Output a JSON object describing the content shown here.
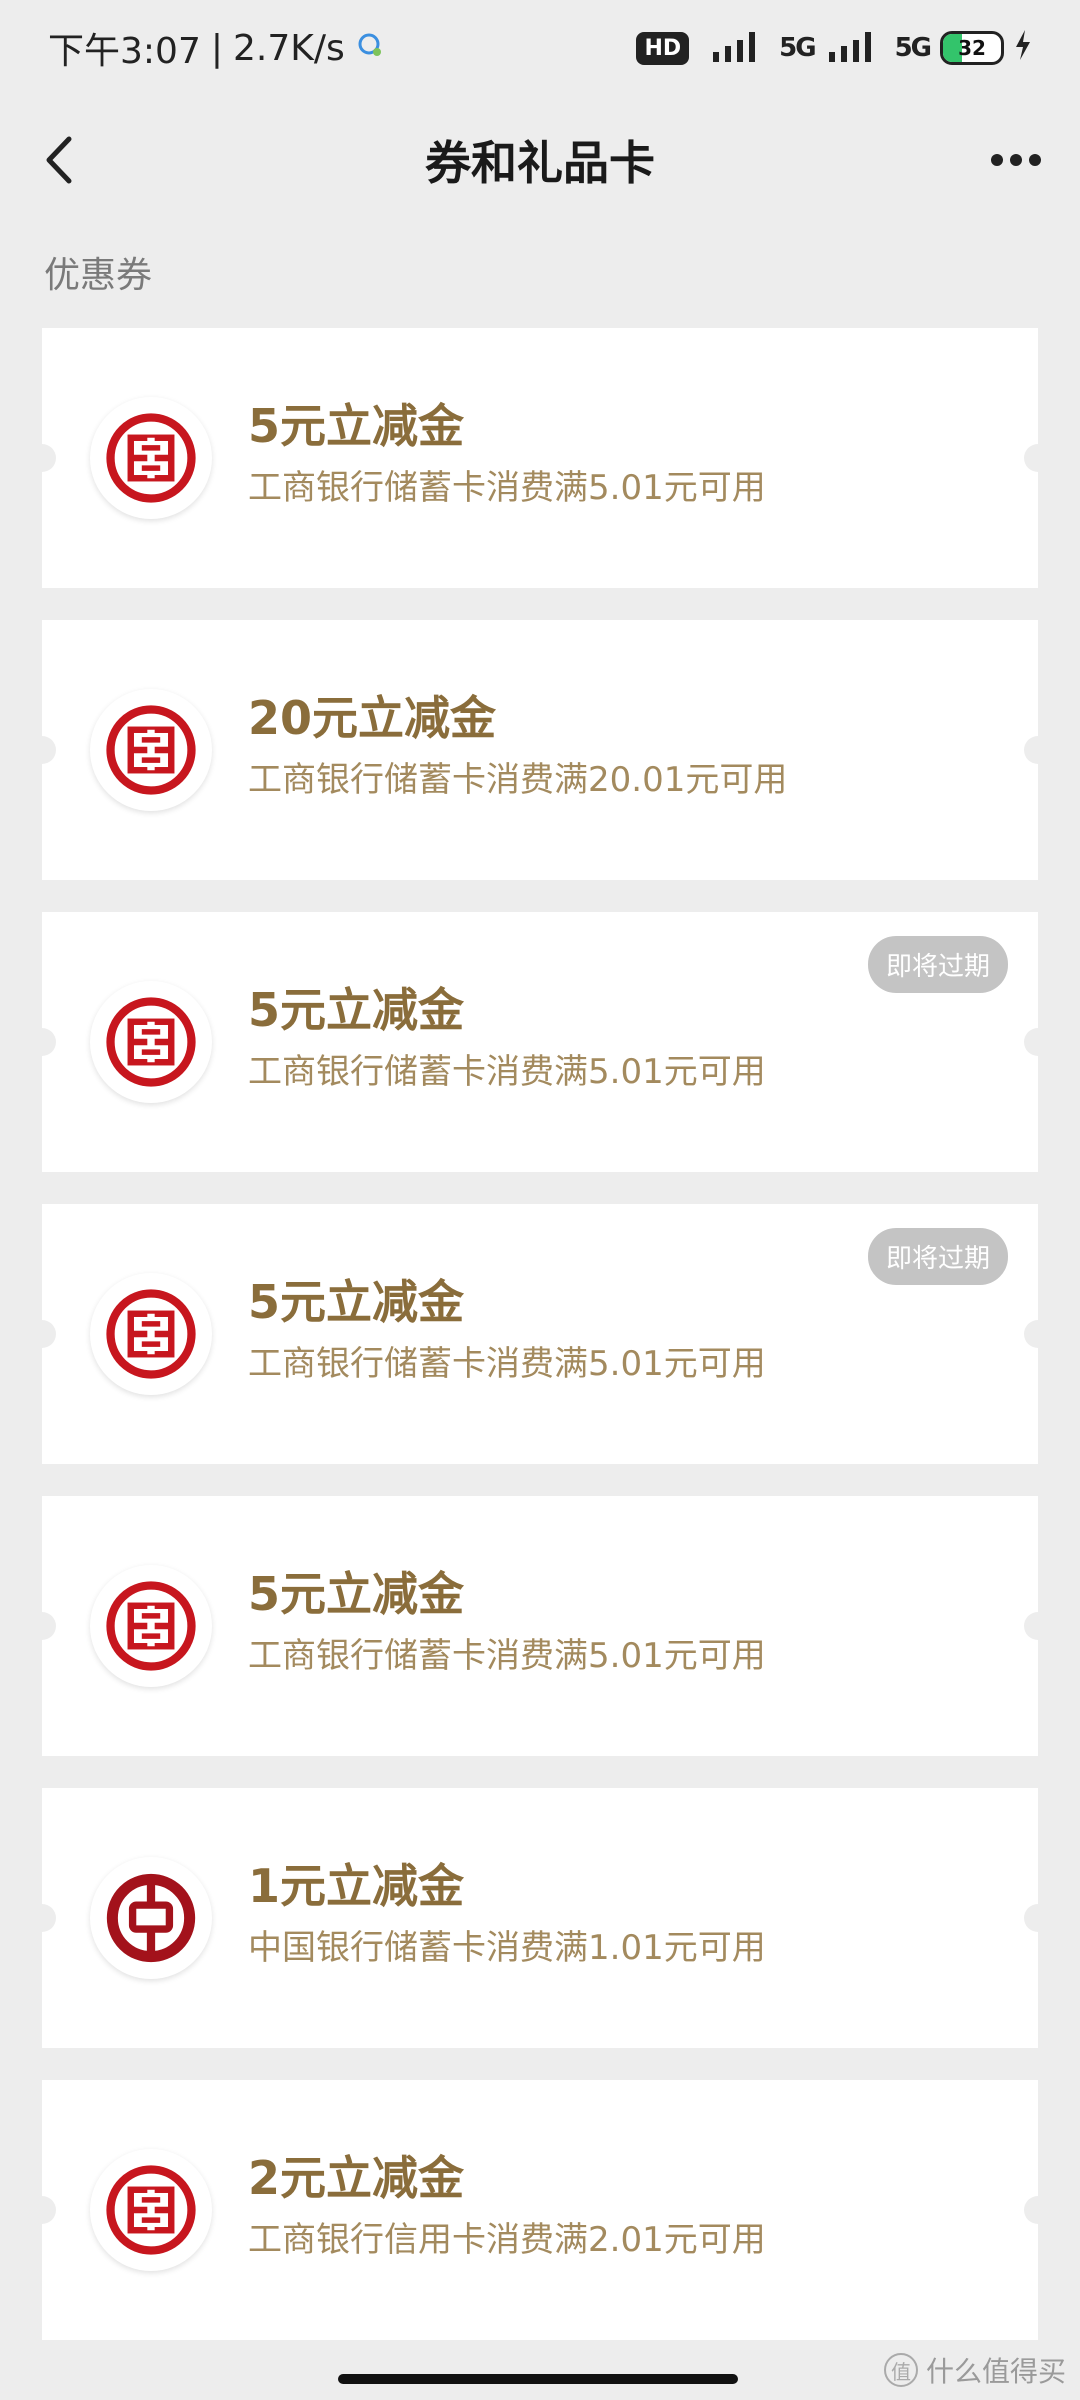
{
  "status_bar": {
    "time": "下午3:07",
    "speed": "2.7K/s",
    "hd": "HD",
    "signal1": "5G",
    "signal2": "5G",
    "battery": "32",
    "battery_level": 0.32
  },
  "nav": {
    "title": "券和礼品卡"
  },
  "section": {
    "label": "优惠券"
  },
  "coupons": [
    {
      "title": "5元立减金",
      "desc": "工商银行储蓄卡消费满5.01元可用",
      "bank": "icbc",
      "badge": ""
    },
    {
      "title": "20元立减金",
      "desc": "工商银行储蓄卡消费满20.01元可用",
      "bank": "icbc",
      "badge": ""
    },
    {
      "title": "5元立减金",
      "desc": "工商银行储蓄卡消费满5.01元可用",
      "bank": "icbc",
      "badge": "即将过期"
    },
    {
      "title": "5元立减金",
      "desc": "工商银行储蓄卡消费满5.01元可用",
      "bank": "icbc",
      "badge": "即将过期"
    },
    {
      "title": "5元立减金",
      "desc": "工商银行储蓄卡消费满5.01元可用",
      "bank": "icbc",
      "badge": ""
    },
    {
      "title": "1元立减金",
      "desc": "中国银行储蓄卡消费满1.01元可用",
      "bank": "boc",
      "badge": ""
    },
    {
      "title": "2元立减金",
      "desc": "工商银行信用卡消费满2.01元可用",
      "bank": "icbc",
      "badge": ""
    }
  ],
  "watermark": {
    "text": "什么值得买",
    "icon": "值"
  },
  "colors": {
    "icbc_red": "#c7161e",
    "boc_red": "#a3121b",
    "coupon_title": "#8a6d3b",
    "coupon_desc": "#a38a5e",
    "badge_bg": "#c4c4c4",
    "page_bg": "#ededed"
  },
  "icons": {
    "back": "chevron-left-icon",
    "more": "more-dots-icon",
    "icbc": "icbc-logo-icon",
    "boc": "boc-logo-icon"
  }
}
